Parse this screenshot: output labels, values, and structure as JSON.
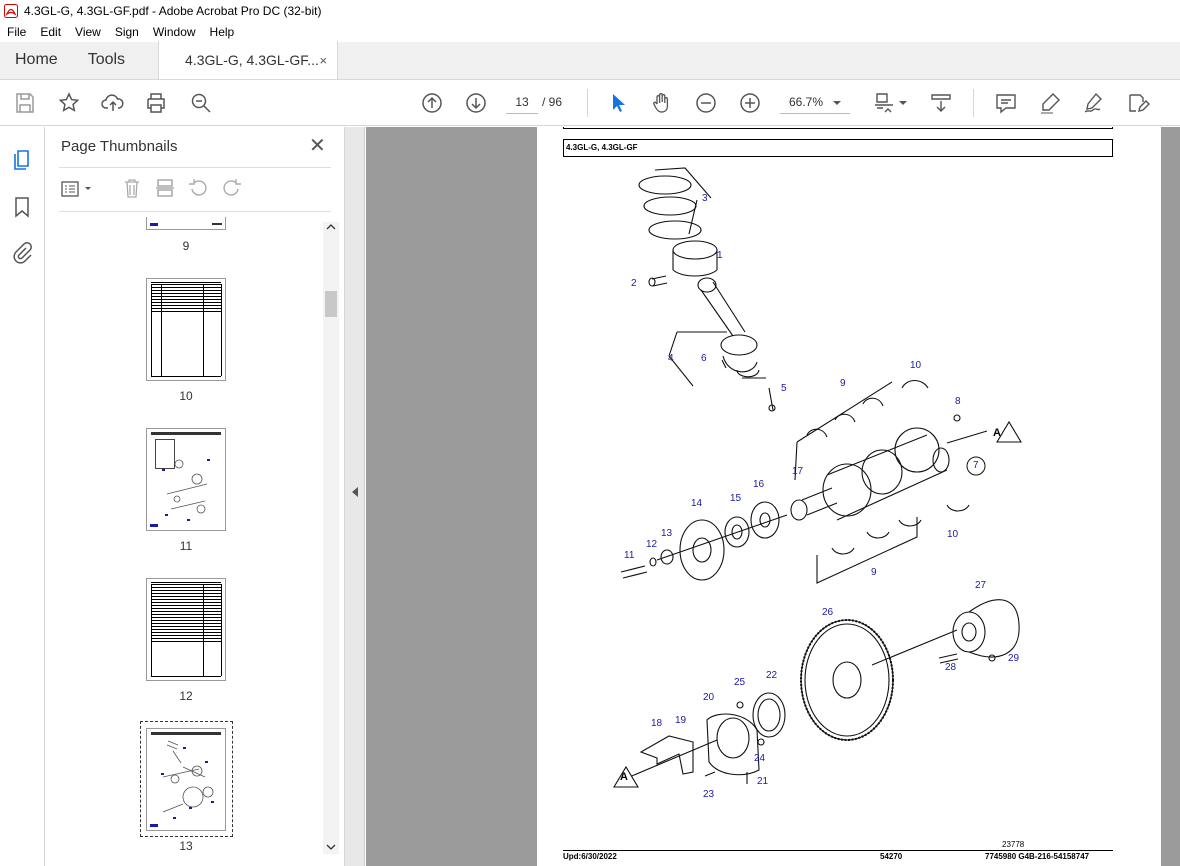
{
  "window": {
    "title": "4.3GL-G, 4.3GL-GF.pdf - Adobe Acrobat Pro DC (32-bit)"
  },
  "menu": [
    "File",
    "Edit",
    "View",
    "Sign",
    "Window",
    "Help"
  ],
  "tabs": {
    "home": "Home",
    "tools": "Tools",
    "document": "4.3GL-G, 4.3GL-GF...",
    "close": "×"
  },
  "toolbar": {
    "page_current": "13",
    "page_total": "/ 96",
    "zoom": "66.7%"
  },
  "panel": {
    "title": "Page Thumbnails",
    "close": "✕",
    "thumbnails": [
      {
        "label": "9"
      },
      {
        "label": "10"
      },
      {
        "label": "11"
      },
      {
        "label": "12"
      },
      {
        "label": "13"
      }
    ]
  },
  "page": {
    "header": "4.3GL-G, 4.3GL-GF",
    "footer_date": "Upd:6/30/2022",
    "footer_code": "54270",
    "footer_ref": "7745980  G4B-216-54158747",
    "figure_number": "23778",
    "callouts": [
      "1",
      "2",
      "3",
      "4",
      "5",
      "6",
      "7",
      "8",
      "9",
      "9",
      "10",
      "10",
      "11",
      "12",
      "13",
      "14",
      "15",
      "16",
      "17",
      "18",
      "19",
      "20",
      "21",
      "22",
      "23",
      "24",
      "25",
      "26",
      "27",
      "28",
      "29"
    ],
    "section_marks": [
      "A",
      "A"
    ]
  },
  "colors": {
    "accent": "#1473e6",
    "callout": "#1a1aa8",
    "doc_bg": "#9b9b9b"
  }
}
